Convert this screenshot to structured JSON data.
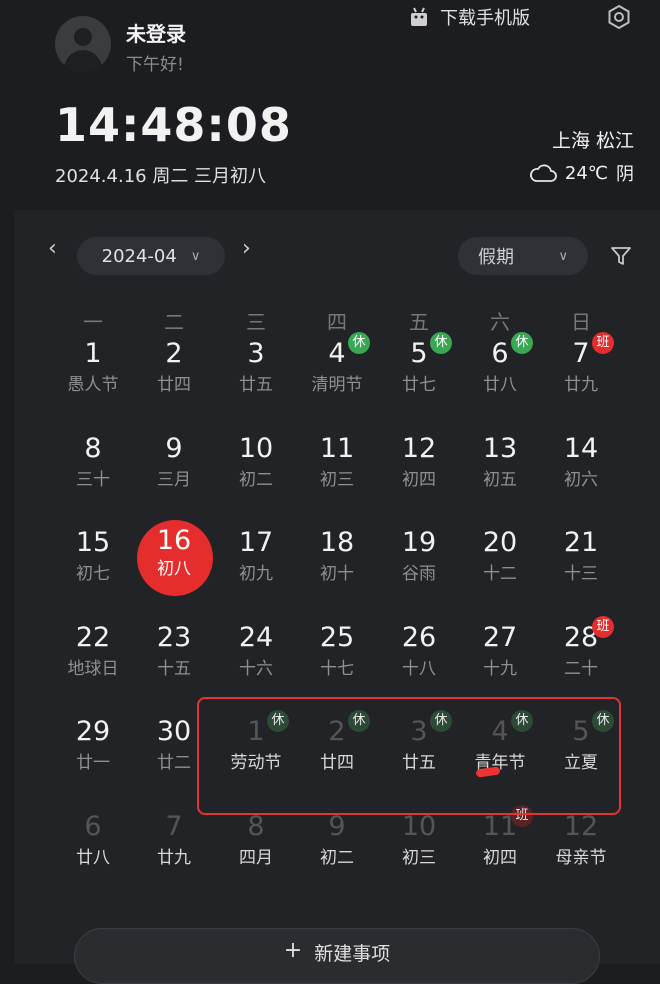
{
  "user": {
    "name": "未登录",
    "greeting": "下午好!"
  },
  "toolbar": {
    "download_label": "下载手机版"
  },
  "clock": {
    "time": "14:48:08",
    "date": "2024.4.16 周二 三月初八"
  },
  "weather": {
    "city": "上海 松江",
    "temp": "24℃",
    "condition": "阴"
  },
  "calendar": {
    "month_label": "2024-04",
    "filter_label": "假期",
    "weekdays": [
      "一",
      "二",
      "三",
      "四",
      "五",
      "六",
      "日"
    ],
    "weeks": [
      [
        {
          "day": "1",
          "lunar": "愚人节"
        },
        {
          "day": "2",
          "lunar": "廿四"
        },
        {
          "day": "3",
          "lunar": "廿五"
        },
        {
          "day": "4",
          "lunar": "清明节",
          "badge": "休"
        },
        {
          "day": "5",
          "lunar": "廿七",
          "badge": "休"
        },
        {
          "day": "6",
          "lunar": "廿八",
          "badge": "休"
        },
        {
          "day": "7",
          "lunar": "廿九",
          "badge": "班"
        }
      ],
      [
        {
          "day": "8",
          "lunar": "三十"
        },
        {
          "day": "9",
          "lunar": "三月"
        },
        {
          "day": "10",
          "lunar": "初二"
        },
        {
          "day": "11",
          "lunar": "初三"
        },
        {
          "day": "12",
          "lunar": "初四"
        },
        {
          "day": "13",
          "lunar": "初五"
        },
        {
          "day": "14",
          "lunar": "初六"
        }
      ],
      [
        {
          "day": "15",
          "lunar": "初七"
        },
        {
          "day": "16",
          "lunar": "初八",
          "today": true
        },
        {
          "day": "17",
          "lunar": "初九"
        },
        {
          "day": "18",
          "lunar": "初十"
        },
        {
          "day": "19",
          "lunar": "谷雨"
        },
        {
          "day": "20",
          "lunar": "十二"
        },
        {
          "day": "21",
          "lunar": "十三"
        }
      ],
      [
        {
          "day": "22",
          "lunar": "地球日"
        },
        {
          "day": "23",
          "lunar": "十五"
        },
        {
          "day": "24",
          "lunar": "十六"
        },
        {
          "day": "25",
          "lunar": "十七"
        },
        {
          "day": "26",
          "lunar": "十八"
        },
        {
          "day": "27",
          "lunar": "十九"
        },
        {
          "day": "28",
          "lunar": "二十",
          "badge": "班"
        }
      ],
      [
        {
          "day": "29",
          "lunar": "廿一"
        },
        {
          "day": "30",
          "lunar": "廿二"
        },
        {
          "day": "1",
          "lunar": "劳动节",
          "badge": "休",
          "other": true
        },
        {
          "day": "2",
          "lunar": "廿四",
          "badge": "休",
          "other": true
        },
        {
          "day": "3",
          "lunar": "廿五",
          "badge": "休",
          "other": true
        },
        {
          "day": "4",
          "lunar": "青年节",
          "badge": "休",
          "other": true
        },
        {
          "day": "5",
          "lunar": "立夏",
          "badge": "休",
          "other": true
        }
      ],
      [
        {
          "day": "6",
          "lunar": "廿八",
          "other": true
        },
        {
          "day": "7",
          "lunar": "廿九",
          "other": true
        },
        {
          "day": "8",
          "lunar": "四月",
          "other": true
        },
        {
          "day": "9",
          "lunar": "初二",
          "other": true
        },
        {
          "day": "10",
          "lunar": "初三",
          "other": true
        },
        {
          "day": "11",
          "lunar": "初四",
          "badge": "班",
          "other": true
        },
        {
          "day": "12",
          "lunar": "母亲节",
          "other": true
        }
      ]
    ]
  },
  "new_item_label": "新建事项",
  "colors": {
    "accent": "#e52d2d",
    "rest_badge": "#3aa754",
    "background": "#1c1d20"
  }
}
